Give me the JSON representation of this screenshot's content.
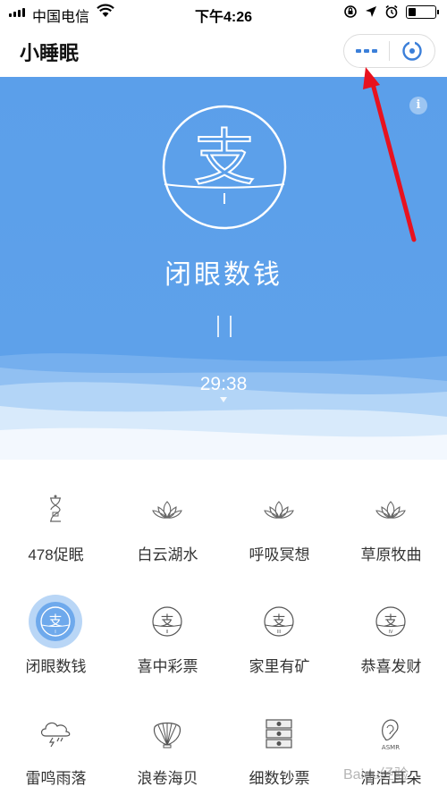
{
  "status_bar": {
    "carrier": "中国电信",
    "time": "下午4:26",
    "battery_level": 0.3
  },
  "header": {
    "title": "小睡眠",
    "more_icon": "more-dots-icon",
    "close_icon": "close-target-icon"
  },
  "hero": {
    "emblem_glyph": "支",
    "title": "闭眼数钱",
    "timer": "29:38",
    "info_label": "i"
  },
  "grid": {
    "items": [
      {
        "label": "478促眠",
        "icon": "hourglass-icon"
      },
      {
        "label": "白云湖水",
        "icon": "lotus-icon"
      },
      {
        "label": "呼吸冥想",
        "icon": "lotus-icon"
      },
      {
        "label": "草原牧曲",
        "icon": "lotus-icon"
      },
      {
        "label": "闭眼数钱",
        "icon": "coin-icon",
        "sub": "I",
        "active": true
      },
      {
        "label": "喜中彩票",
        "icon": "coin-icon",
        "sub": "II"
      },
      {
        "label": "家里有矿",
        "icon": "coin-icon",
        "sub": "III"
      },
      {
        "label": "恭喜发财",
        "icon": "coin-icon",
        "sub": "IV"
      },
      {
        "label": "雷鸣雨落",
        "icon": "storm-cloud-icon"
      },
      {
        "label": "浪卷海贝",
        "icon": "seashell-icon"
      },
      {
        "label": "细数钞票",
        "icon": "banknotes-icon"
      },
      {
        "label": "清洁耳朵",
        "icon": "ear-icon",
        "sub": "ASMR"
      }
    ]
  },
  "watermark": "Baidu经验",
  "colors": {
    "hero_blue": "#5b9fea",
    "accent_blue": "#3b7fd9",
    "annotation_red": "#e8121f"
  }
}
